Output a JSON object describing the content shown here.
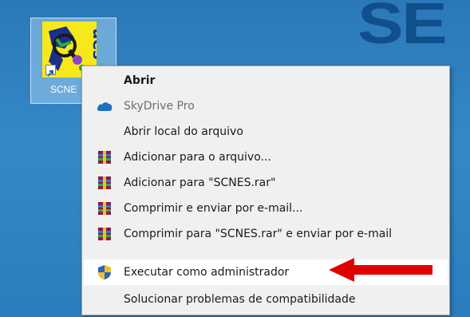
{
  "desktop": {
    "brand_text": "SE",
    "shortcut": {
      "label": "SCNE",
      "icon_letters": "ues"
    }
  },
  "context_menu": {
    "items": [
      {
        "label": "Abrir",
        "bold": true,
        "icon": "none"
      },
      {
        "label": "SkyDrive Pro",
        "muted": true,
        "icon": "skydrive-cloud-icon"
      },
      {
        "label": "Abrir local do arquivo",
        "icon": "none"
      },
      {
        "label": "Adicionar para o arquivo...",
        "icon": "winrar-icon"
      },
      {
        "label": "Adicionar para \"SCNES.rar\"",
        "icon": "winrar-icon"
      },
      {
        "label": "Comprimir e enviar por e-mail...",
        "icon": "winrar-icon"
      },
      {
        "label": "Comprimir para \"SCNES.rar\" e enviar por e-mail",
        "icon": "winrar-icon"
      },
      {
        "label": "Executar como administrador",
        "icon": "uac-shield-icon",
        "highlighted": true
      },
      {
        "label": "Solucionar problemas de compatibilidade",
        "icon": "none"
      }
    ]
  },
  "colors": {
    "desktop_blue": "#2f7fbd",
    "menu_background": "#f0f0f0",
    "highlight": "#ffffff",
    "annotation_arrow": "#e00000"
  }
}
